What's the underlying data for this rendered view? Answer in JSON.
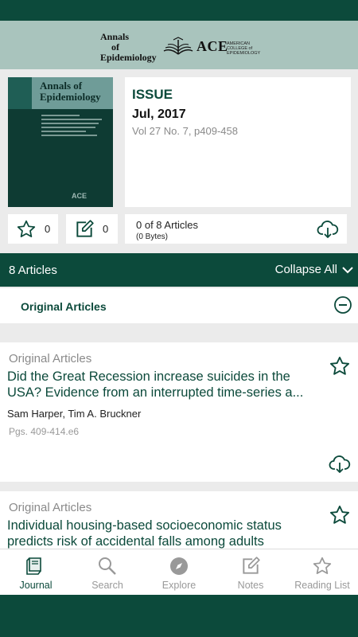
{
  "banner": {
    "journal_name_1": "Annals",
    "journal_name_2": "of",
    "journal_name_3": "Epidemiology",
    "ace": "ACE",
    "ace_sub": "AMERICAN COLLEGE of EPIDEMIOLOGY"
  },
  "cover": {
    "title_1": "Annals of",
    "title_2": "Epidemiology",
    "ace": "ACE"
  },
  "issue": {
    "label": "ISSUE",
    "date": "Jul, 2017",
    "volume": "Vol 27 No. 7, p409-458"
  },
  "stats": {
    "favorites_count": "0",
    "notes_count": "0",
    "articles_downloaded": "0 of 8 Articles",
    "download_size": "(0 Bytes)"
  },
  "articles_bar": {
    "count_label": "8 Articles",
    "collapse_label": "Collapse All"
  },
  "section": {
    "title": "Original Articles"
  },
  "articles": [
    {
      "section": "Original Articles",
      "title": "Did the Great Recession increase suicides in the USA? Evidence from an interrupted time-series a...",
      "authors": "Sam Harper, Tim A. Bruckner",
      "pages": "Pgs. 409-414.e6"
    },
    {
      "section": "Original Articles",
      "title": "Individual housing-based socioeconomic status predicts risk of accidental falls among adults"
    }
  ],
  "nav": {
    "journal": "Journal",
    "search": "Search",
    "explore": "Explore",
    "notes": "Notes",
    "reading_list": "Reading List"
  },
  "colors": {
    "primary": "#0c4a3b",
    "banner": "#a9c4bd",
    "background": "#ebebeb"
  }
}
